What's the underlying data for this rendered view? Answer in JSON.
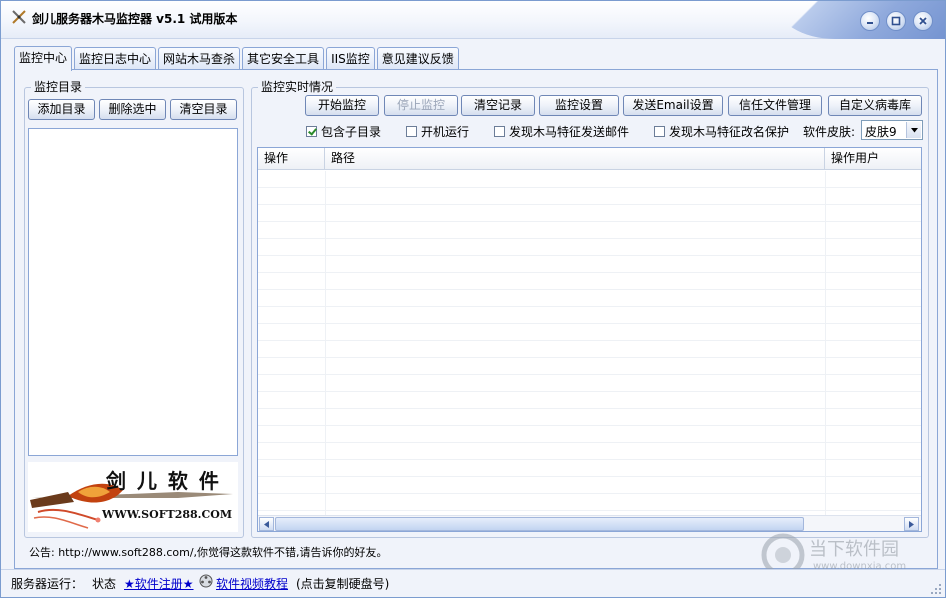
{
  "window": {
    "title": "剑儿服务器木马监控器 v5.1  试用版本"
  },
  "tabs": [
    {
      "label": "监控中心"
    },
    {
      "label": "监控日志中心"
    },
    {
      "label": "网站木马查杀"
    },
    {
      "label": "其它安全工具"
    },
    {
      "label": "IIS监控"
    },
    {
      "label": "意见建议反馈"
    }
  ],
  "left_panel": {
    "legend": "监控目录",
    "buttons": {
      "add": "添加目录",
      "delete": "删除选中",
      "clear": "清空目录"
    },
    "logo": {
      "name": "剑 儿 软 件",
      "url": "WWW.SOFT288.COM"
    }
  },
  "right_panel": {
    "legend": "监控实时情况",
    "buttons": {
      "start": "开始监控",
      "stop": "停止监控",
      "clear_log": "清空记录",
      "settings": "监控设置",
      "email": "发送Email设置",
      "trusted": "信任文件管理",
      "custom": "自定义病毒库"
    },
    "options": {
      "subdirs": "包含子目录",
      "startup": "开机运行",
      "email_on_trojan": "发现木马特征发送邮件",
      "rename_protect": "发现木马特征改名保护"
    },
    "skin": {
      "label": "软件皮肤:",
      "value": "皮肤9"
    },
    "grid": {
      "columns": [
        "操作",
        "路径",
        "操作用户"
      ],
      "rows": []
    }
  },
  "notice": "公告: http://www.soft288.com/,你觉得这款软件不错,请告诉你的好友。",
  "status": {
    "server_label": "服务器运行：",
    "state_label": "状态",
    "register_link": "★软件注册★",
    "video_link": "软件视频教程",
    "hint": "(点击复制硬盘号)"
  },
  "watermark": {
    "brand": "当下软件园",
    "url": "www.downxia.com"
  },
  "colors": {
    "accent": "#7b9ccf",
    "link": "#0000cc",
    "tab_border": "#8ba6d6"
  }
}
